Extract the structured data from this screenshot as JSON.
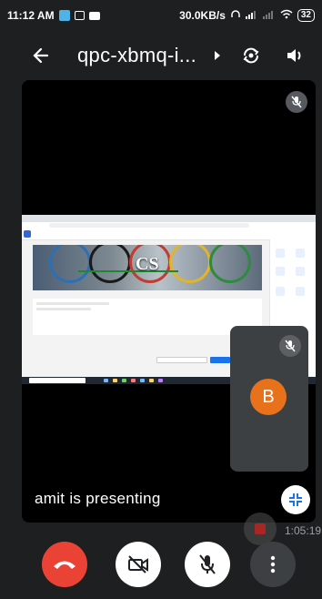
{
  "status_bar": {
    "time": "11:12 AM",
    "network_speed": "30.0KB/s",
    "battery": "32"
  },
  "header": {
    "meeting_code": "qpc-xbmq-i...",
    "icons": [
      "back-arrow-icon",
      "chevron-right-icon",
      "switch-camera-icon",
      "speaker-icon"
    ]
  },
  "shared_screen": {
    "banner_text": "CS"
  },
  "self_view": {
    "avatar_letter": "B",
    "mic_state": "muted"
  },
  "presentation": {
    "status_text": "amit is presenting"
  },
  "recording": {
    "elapsed": "1:05:19"
  },
  "controls": {
    "items": [
      "end-call",
      "camera-off",
      "mic-off",
      "more-options"
    ]
  },
  "colors": {
    "end_call": "#ea4335",
    "avatar": "#e8711c",
    "tile_bg": "#3c4043",
    "background": "#1e1f20"
  }
}
